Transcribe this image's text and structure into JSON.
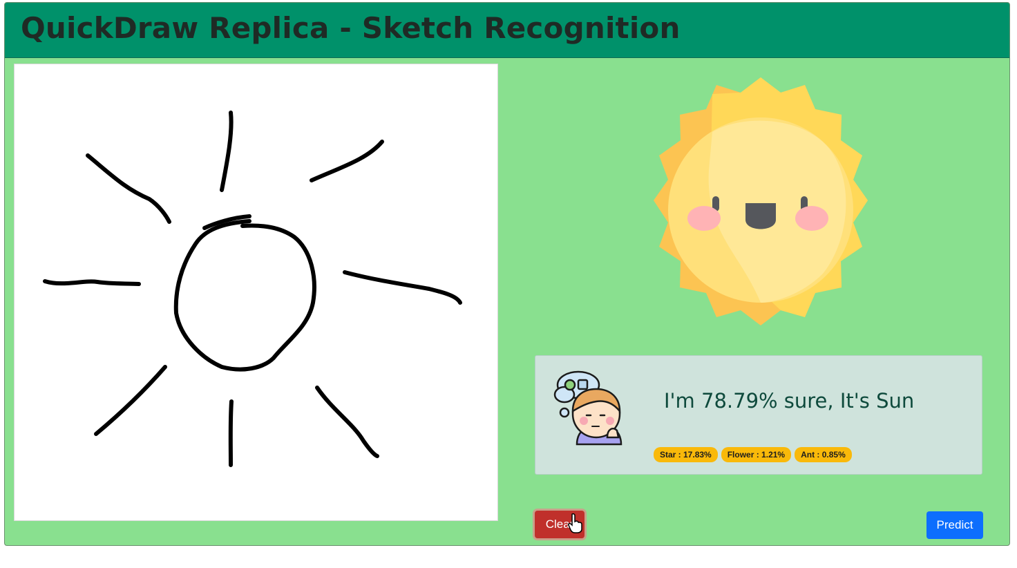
{
  "header": {
    "title": "QuickDraw Replica - Sketch Recognition"
  },
  "prediction": {
    "headline": "I'm 78.79% sure, It's Sun",
    "alternatives": [
      {
        "label": "Star : 17.83%"
      },
      {
        "label": "Flower : 1.21%"
      },
      {
        "label": "Ant : 0.85%"
      }
    ]
  },
  "buttons": {
    "clear": "Clear",
    "predict": "Predict"
  },
  "icons": {
    "result": "sun-face-icon",
    "thinker": "thinking-person-icon",
    "cursor": "hand-pointer-icon"
  },
  "colors": {
    "header": "#00916a",
    "background": "#89e08f",
    "clear_button": "#c0302b",
    "predict_button": "#0d6efd",
    "badge": "#f9b90a"
  }
}
